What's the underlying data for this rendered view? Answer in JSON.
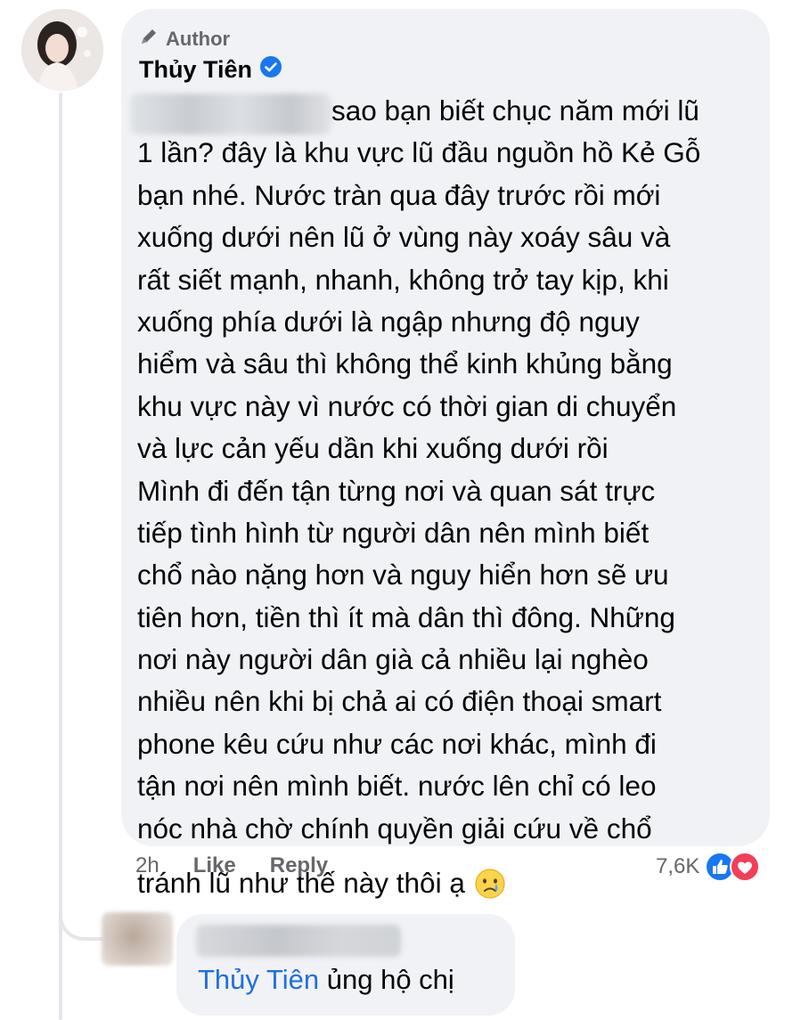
{
  "comment": {
    "badge": "Author",
    "author_name": "Thủy Tiên",
    "verified_icon": "verified-check-icon",
    "pen_icon": "pen-icon",
    "lines": [
      "sao bạn biết chục năm mới lũ",
      "1 lần? đây là khu vực lũ đầu nguồn hồ Kẻ Gỗ",
      "bạn nhé. Nước tràn qua đây trước rồi mới",
      "xuống dưới nên lũ ở vùng này xoáy sâu và",
      "rất siết mạnh, nhanh, không trở tay kịp, khi",
      "xuống phía dưới là ngập nhưng độ nguy",
      "hiểm và sâu thì không thể kinh khủng bằng",
      "khu vực này vì nước có thời gian di chuyển",
      "và lực cản yếu dần khi xuống dưới rồi",
      "Mình đi đến tận từng nơi và quan sát trực",
      "tiếp tình hình từ người dân nên mình biết",
      "chổ nào nặng hơn và nguy hiển hơn sẽ ưu",
      "tiên hơn, tiền thì ít mà dân thì đông. Những",
      "nơi này người dân già cả nhiều lại nghèo",
      "nhiều nên khi bị chả ai có điện thoại smart",
      "phone kêu cứu như các nơi khác, mình đi",
      "tận nơi nên mình biết. nước lên chỉ có leo",
      "nóc nhà chờ chính quyền giải cứu về chổ",
      "tránh lũ như thế này thôi ạ"
    ],
    "emoji": "crying-face-icon",
    "time": "2h",
    "like_label": "Like",
    "reply_label": "Reply",
    "reaction_count": "7,6K",
    "reaction_icons": [
      "like-reaction-icon",
      "love-reaction-icon"
    ]
  },
  "reply": {
    "tag": "Thủy Tiên",
    "text": " ủng hộ chị"
  },
  "colors": {
    "bubble": "#f0f2f5",
    "meta_text": "#65676b",
    "link": "#216fdb",
    "verified": "#1877f2",
    "like_blue": "#1877f2",
    "love_red": "#f33e58"
  }
}
